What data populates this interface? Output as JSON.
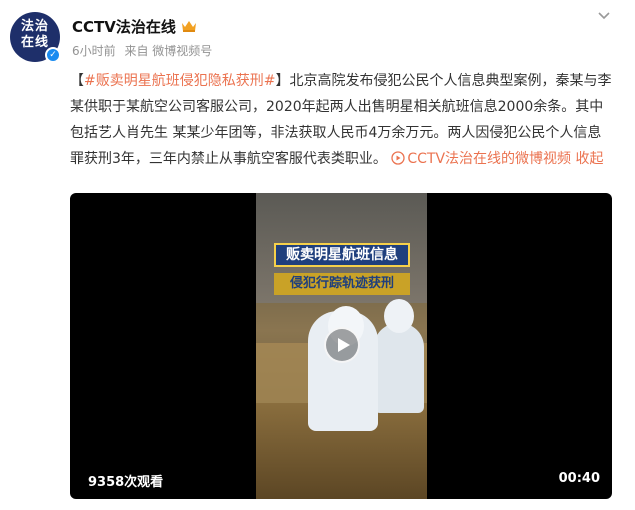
{
  "author": {
    "avatar_text_line1": "法治",
    "avatar_text_line2": "在线",
    "name": "CCTV法治在线",
    "badge_icon": "crown-icon",
    "verified_icon": "verified-check-icon"
  },
  "meta": {
    "time": "6小时前",
    "source_label": "来自 微博视频号"
  },
  "post": {
    "bracket_open": "【",
    "topic": "#贩卖明星航班侵犯隐私获刑#",
    "bracket_close": "】",
    "body": "北京高院发布侵犯公民个人信息典型案例，秦某与李某供职于某航空公司客服公司，2020年起两人出售明星相关航班信息2000余条。其中包括艺人肖先生 某某少年团等，非法获取人民币4万余万元。两人因侵犯公民个人信息罪获刑3年，三年内禁止从事航空客服代表类职业。",
    "video_link": "CCTV法治在线的微博视频",
    "collapse": "收起"
  },
  "video": {
    "caption_line1": "贩卖明星航班信息",
    "caption_line2": "侵犯行踪轨迹获刑",
    "view_count": "9358次观看",
    "duration": "00:40"
  },
  "colors": {
    "accent": "#eb7350",
    "avatar_bg": "#1e2f6a",
    "verified": "#1a8bf0"
  }
}
